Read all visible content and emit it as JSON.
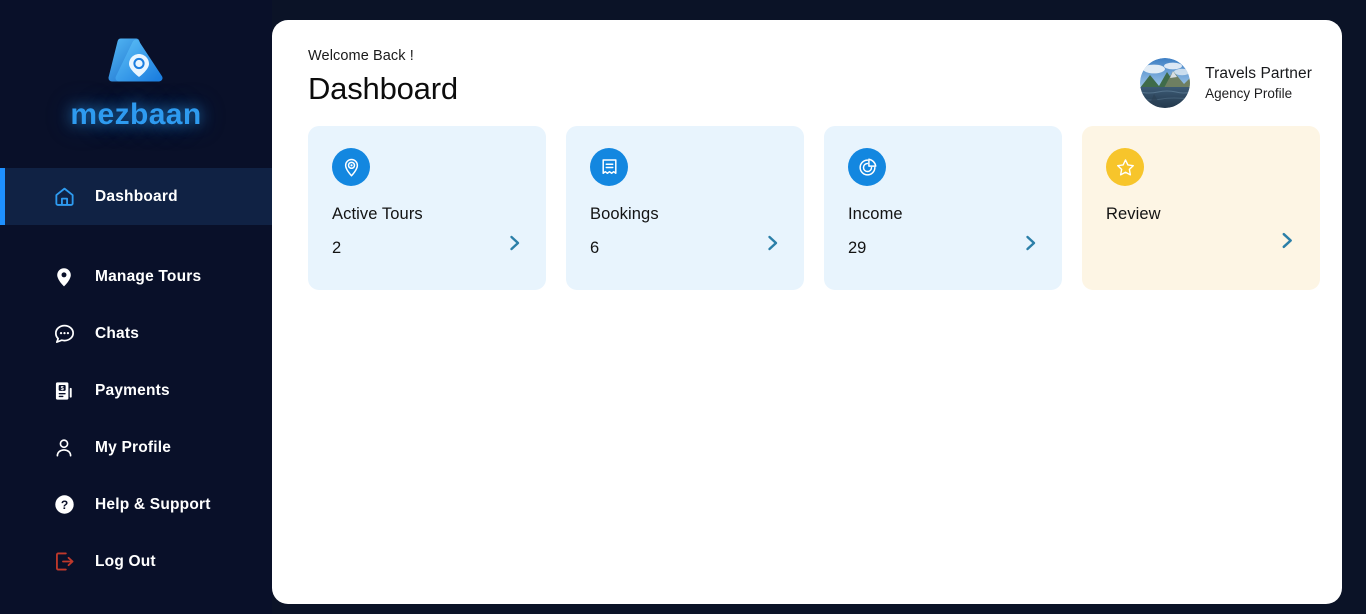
{
  "brand": {
    "name": "mezbaan",
    "logo_icon": "mountain-pin-logo",
    "logo_color": "#2E9BF0"
  },
  "sidebar": {
    "background": "#091029",
    "active_accent": "#1E90FF",
    "items": [
      {
        "label": "Dashboard",
        "icon": "home-icon",
        "active": true
      },
      {
        "label": "Manage Tours",
        "icon": "location-pin-icon",
        "active": false
      },
      {
        "label": "Chats",
        "icon": "chat-bubble-icon",
        "active": false
      },
      {
        "label": "Payments",
        "icon": "invoice-dollar-icon",
        "active": false
      },
      {
        "label": "My Profile",
        "icon": "user-icon",
        "active": false
      },
      {
        "label": "Help & Support",
        "icon": "question-mark-icon",
        "active": false
      },
      {
        "label": "Log Out",
        "icon": "logout-arrow-icon",
        "active": false
      }
    ]
  },
  "header": {
    "welcome": "Welcome Back !",
    "title": "Dashboard",
    "profile": {
      "name": "Travels Partner",
      "role": "Agency Profile",
      "avatar_icon": "landscape-photo-avatar"
    }
  },
  "cards": [
    {
      "label": "Active Tours",
      "value": "2",
      "icon": "location-target-icon",
      "theme": "blue",
      "icon_color": "#1387E0",
      "background": "#E8F4FD"
    },
    {
      "label": "Bookings",
      "value": "6",
      "icon": "receipt-icon",
      "theme": "blue",
      "icon_color": "#1387E0",
      "background": "#E8F4FD"
    },
    {
      "label": "Income",
      "value": "29",
      "icon": "pie-chart-icon",
      "theme": "blue",
      "icon_color": "#1387E0",
      "background": "#E8F4FD"
    },
    {
      "label": "Review",
      "value": "",
      "icon": "star-icon",
      "theme": "cream",
      "icon_color": "#F7C52B",
      "background": "#FDF5E4"
    }
  ]
}
